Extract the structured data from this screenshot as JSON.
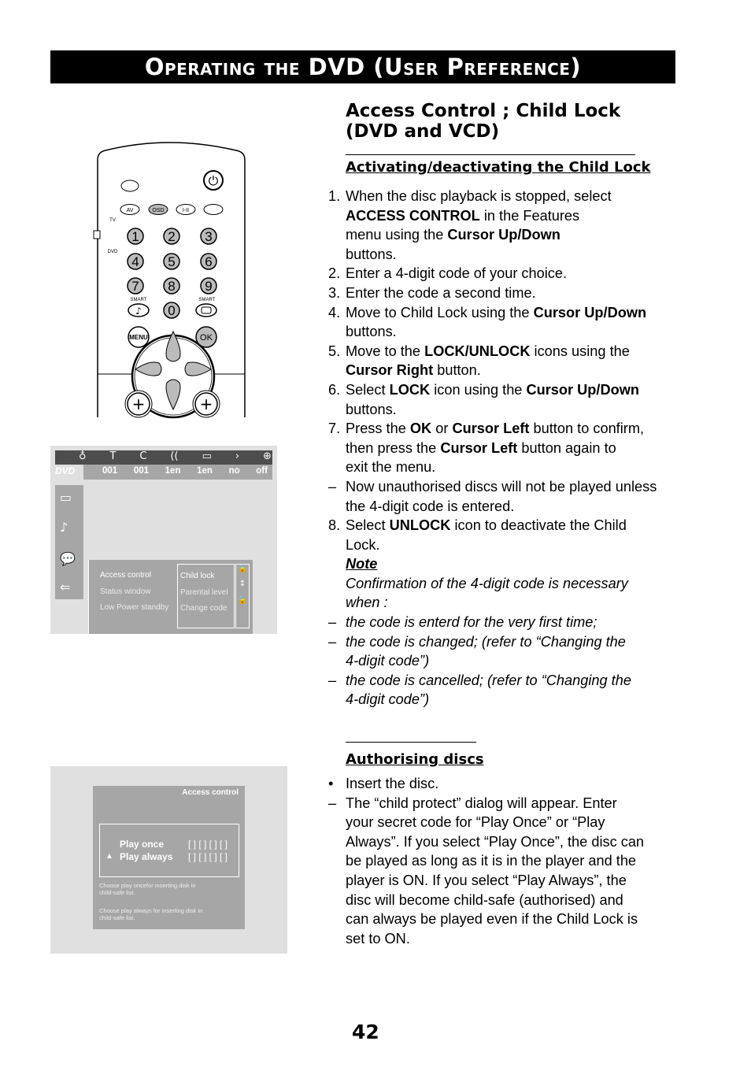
{
  "banner": {
    "title": "Operating the DVD (User Preference)"
  },
  "heading": "Access Control ; Child Lock (DVD and VCD)",
  "section1": {
    "title": "Activating/deactivating the Child Lock",
    "items": [
      {
        "mark": "1.",
        "seg": [
          {
            "t": "When the disc playback is stopped, select\n"
          },
          {
            "t": "ACCESS CONTROL",
            "b": true
          },
          {
            "t": " in the Features\nmenu using the "
          },
          {
            "t": "Cursor Up/Down",
            "b": true
          },
          {
            "t": "\nbuttons."
          }
        ]
      },
      {
        "mark": "2.",
        "seg": [
          {
            "t": "Enter a 4-digit code of your choice."
          }
        ]
      },
      {
        "mark": "3.",
        "seg": [
          {
            "t": "Enter the code a second time."
          }
        ]
      },
      {
        "mark": "4.",
        "seg": [
          {
            "t": "Move to Child Lock using the "
          },
          {
            "t": "Cursor Up/Down",
            "b": true
          },
          {
            "t": "\nbuttons."
          }
        ]
      },
      {
        "mark": "5.",
        "seg": [
          {
            "t": "Move to the "
          },
          {
            "t": "LOCK/UNLOCK",
            "b": true
          },
          {
            "t": " icons using the\n"
          },
          {
            "t": "Cursor Right",
            "b": true
          },
          {
            "t": " button."
          }
        ]
      },
      {
        "mark": "6.",
        "seg": [
          {
            "t": "Select "
          },
          {
            "t": "LOCK",
            "b": true
          },
          {
            "t": " icon using the "
          },
          {
            "t": "Cursor Up/Down",
            "b": true
          },
          {
            "t": "\nbuttons."
          }
        ]
      },
      {
        "mark": "7.",
        "seg": [
          {
            "t": "Press the "
          },
          {
            "t": "OK",
            "b": true
          },
          {
            "t": " or "
          },
          {
            "t": "Cursor Left",
            "b": true
          },
          {
            "t": " button to confirm,\nthen press the "
          },
          {
            "t": "Cursor Left",
            "b": true
          },
          {
            "t": " button again to\nexit the menu."
          }
        ]
      },
      {
        "mark": "–",
        "seg": [
          {
            "t": "Now unauthorised discs will not be played unless\nthe 4-digit code is entered."
          }
        ]
      },
      {
        "mark": "8.",
        "seg": [
          {
            "t": "Select "
          },
          {
            "t": "UNLOCK",
            "b": true
          },
          {
            "t": " icon to deactivate the Child\nLock."
          }
        ]
      }
    ],
    "note_title": "Note",
    "note_text": "Confirmation of the 4-digit code is necessary\nwhen :",
    "note_items": [
      {
        "mark": "–",
        "text": "the code is enterd for the very first time;"
      },
      {
        "mark": "–",
        "text": "the code is changed; (refer to “Changing the\n4-digit code”)"
      },
      {
        "mark": "–",
        "text": "the code is cancelled; (refer to “Changing the\n4-digit code”)"
      }
    ]
  },
  "section2": {
    "title": "Authorising discs",
    "items": [
      {
        "mark": "•",
        "seg": [
          {
            "t": "Insert the disc."
          }
        ]
      },
      {
        "mark": "–",
        "seg": [
          {
            "t": "The “child protect” dialog will appear. Enter\nyour secret code for “Play Once” or “Play\nAlways”. If you select “Play Once”, the disc can\nbe played as long as it is in the player and the\nplayer is ON. If you select “Play Always”, the\ndisc will become child-safe (authorised) and\ncan always be played even if the Child Lock is\nset to ON."
          }
        ]
      }
    ]
  },
  "remote": {
    "keys": [
      "1",
      "2",
      "3",
      "4",
      "5",
      "6",
      "7",
      "8",
      "9",
      "0"
    ],
    "av": "AV",
    "osd": "OSD",
    "dual": "I-II",
    "smart": "SMART",
    "menu": "MENU",
    "ok": "OK",
    "tv": "TV",
    "dvd": "DVD"
  },
  "osd_menu": {
    "logo": "DVD",
    "status": [
      "001",
      "001",
      "1en",
      "1en",
      "no",
      "off"
    ],
    "main": [
      "Access control",
      "Status window",
      "Low Power standby"
    ],
    "sub": [
      "Child lock",
      "Parental level",
      "Change code"
    ],
    "icons": [
      "title-icon",
      "chapter-icon",
      "audio-icon",
      "subtitle-icon",
      "angle-icon",
      "zoom-icon"
    ]
  },
  "access_dialog": {
    "title": "Access control",
    "options": [
      "Play once",
      "Play always"
    ],
    "code": "[ ] [ ] [ ] [ ]",
    "help1": "Choose play oncefor inserting disk in\nchild-safe list.",
    "help2": "Choose play always for inserting disk in\nchild-safe list."
  },
  "page_number": "42",
  "colors": {
    "osd_grey": "#a6a6a6",
    "osd_bar": "#4d4d4d",
    "panel": "#e0e0e0"
  }
}
